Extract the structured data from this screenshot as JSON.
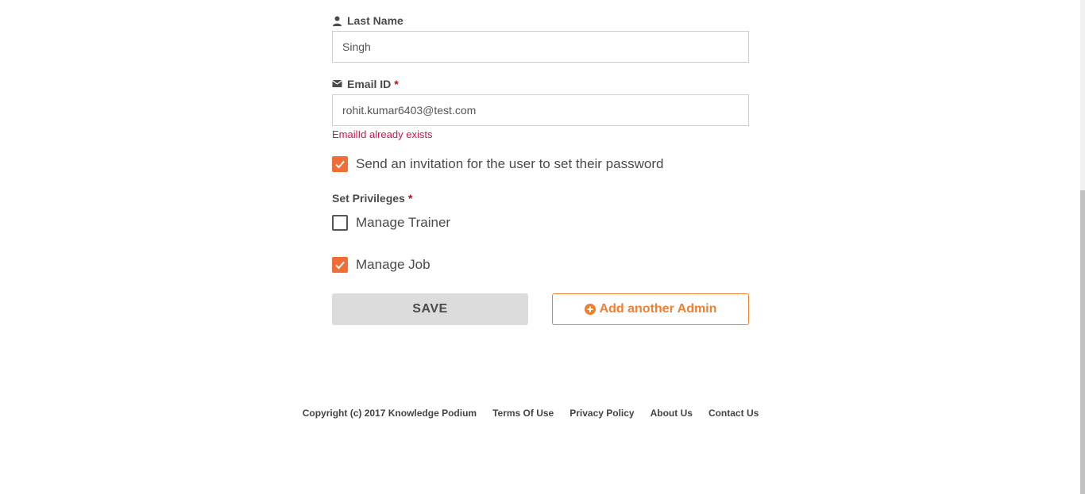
{
  "form": {
    "last_name": {
      "label": "Last Name",
      "value": "Singh",
      "icon": "user-icon"
    },
    "email": {
      "label": "Email ID",
      "required_mark": "*",
      "value": "rohit.kumar6403@test.com",
      "icon": "envelope-icon",
      "error": "EmailId already exists"
    },
    "invite": {
      "label": "Send an invitation for the user to set their password",
      "checked": true
    },
    "privileges": {
      "label": "Set Privileges",
      "required_mark": "*",
      "items": [
        {
          "label": "Manage Trainer",
          "checked": false
        },
        {
          "label": "Manage Job",
          "checked": true
        }
      ]
    },
    "buttons": {
      "save": "SAVE",
      "add_admin": "Add another Admin"
    }
  },
  "footer": {
    "copyright": "Copyright (c) 2017 Knowledge Podium",
    "links": [
      "Terms Of Use",
      "Privacy Policy",
      "About Us",
      "Contact Us"
    ]
  },
  "colors": {
    "accent": "#f26d35",
    "error": "#c9184a",
    "required": "#d0021b"
  }
}
